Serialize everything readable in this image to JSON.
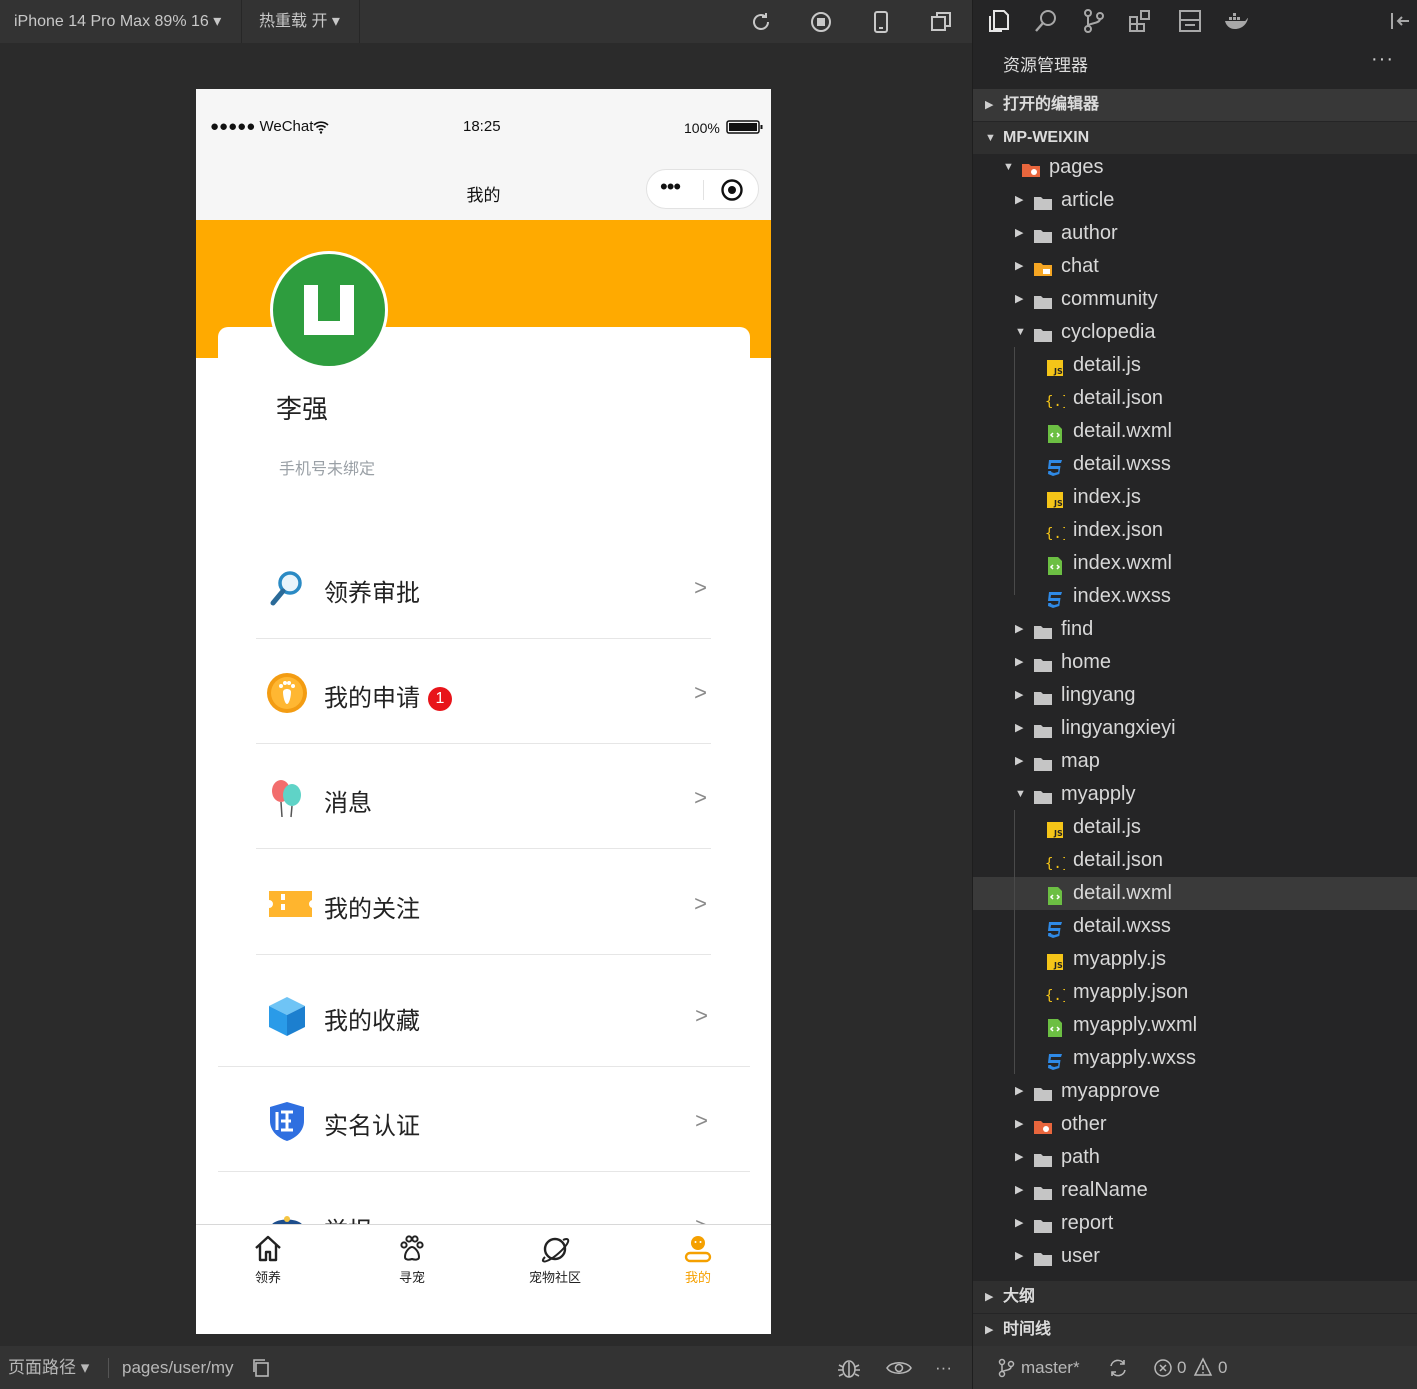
{
  "toolbar": {
    "device": "iPhone 14 Pro Max 89% 16 ▾",
    "hot_reload": "热重载 开 ▾"
  },
  "phone": {
    "status": {
      "carrier": "●●●●● WeChat",
      "time": "18:25",
      "battery": "100%"
    },
    "nav_title": "我的",
    "capsule_dots": "•••",
    "user": {
      "name": "李强",
      "phone": "手机号未绑定"
    },
    "menu": [
      {
        "label": "领养审批",
        "arrow": ">"
      },
      {
        "label": "我的申请",
        "badge": "1",
        "arrow": ">"
      },
      {
        "label": "消息",
        "arrow": ">"
      },
      {
        "label": "我的关注",
        "arrow": ">"
      },
      {
        "label": "我的收藏",
        "arrow": ">"
      },
      {
        "label": "实名认证",
        "arrow": ">"
      },
      {
        "label": "举报",
        "arrow": ">"
      }
    ],
    "tabs": [
      {
        "label": "领养",
        "icon": "home-icon"
      },
      {
        "label": "寻宠",
        "icon": "paw-icon"
      },
      {
        "label": "宠物社区",
        "icon": "planet-icon"
      },
      {
        "label": "我的",
        "icon": "user-icon",
        "active": true
      }
    ]
  },
  "bottom": {
    "path_label": "页面路径 ▾",
    "path": "pages/user/my",
    "more": "···"
  },
  "explorer": {
    "title": "资源管理器",
    "more": "···",
    "sections": {
      "open_editors": "打开的编辑器",
      "project": "MP-WEIXIN",
      "outline": "大纲",
      "timeline": "时间线"
    },
    "tree": [
      {
        "name": "pages",
        "type": "folder-red",
        "open": true
      },
      {
        "name": "article",
        "type": "folder"
      },
      {
        "name": "author",
        "type": "folder"
      },
      {
        "name": "chat",
        "type": "folder-orange"
      },
      {
        "name": "community",
        "type": "folder"
      },
      {
        "name": "cyclopedia",
        "type": "folder",
        "open": true
      },
      {
        "name": "detail.js",
        "type": "js"
      },
      {
        "name": "detail.json",
        "type": "json"
      },
      {
        "name": "detail.wxml",
        "type": "wxml"
      },
      {
        "name": "detail.wxss",
        "type": "wxss"
      },
      {
        "name": "index.js",
        "type": "js"
      },
      {
        "name": "index.json",
        "type": "json"
      },
      {
        "name": "index.wxml",
        "type": "wxml"
      },
      {
        "name": "index.wxss",
        "type": "wxss"
      },
      {
        "name": "find",
        "type": "folder"
      },
      {
        "name": "home",
        "type": "folder"
      },
      {
        "name": "lingyang",
        "type": "folder"
      },
      {
        "name": "lingyangxieyi",
        "type": "folder"
      },
      {
        "name": "map",
        "type": "folder"
      },
      {
        "name": "myapply",
        "type": "folder",
        "open": true
      },
      {
        "name": "detail.js",
        "type": "js"
      },
      {
        "name": "detail.json",
        "type": "json"
      },
      {
        "name": "detail.wxml",
        "type": "wxml",
        "selected": true
      },
      {
        "name": "detail.wxss",
        "type": "wxss"
      },
      {
        "name": "myapply.js",
        "type": "js"
      },
      {
        "name": "myapply.json",
        "type": "json"
      },
      {
        "name": "myapply.wxml",
        "type": "wxml"
      },
      {
        "name": "myapply.wxss",
        "type": "wxss"
      },
      {
        "name": "myapprove",
        "type": "folder"
      },
      {
        "name": "other",
        "type": "folder-red"
      },
      {
        "name": "path",
        "type": "folder"
      },
      {
        "name": "realName",
        "type": "folder"
      },
      {
        "name": "report",
        "type": "folder"
      },
      {
        "name": "user",
        "type": "folder"
      }
    ],
    "status": {
      "branch": "master*",
      "errors": "0",
      "warnings": "0"
    }
  },
  "colors": {
    "accent": "#ffaa00",
    "avatar": "#2e9d3e",
    "badge": "#e8141a",
    "selected_row": "#3a3a3a"
  }
}
